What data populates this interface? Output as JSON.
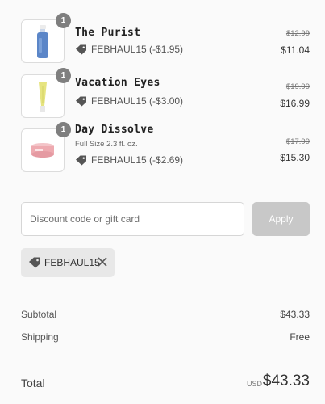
{
  "cart": {
    "items": [
      {
        "quantity": "1",
        "name": "The Purist",
        "variant": "",
        "discount": "FEBHAUL15 (-$1.95)",
        "original_price": "$12.99",
        "price": "$11.04",
        "image": "blue-bottle-product"
      },
      {
        "quantity": "1",
        "name": "Vacation Eyes",
        "variant": "",
        "discount": "FEBHAUL15 (-$3.00)",
        "original_price": "$19.99",
        "price": "$16.99",
        "image": "yellow-tube-product"
      },
      {
        "quantity": "1",
        "name": "Day Dissolve",
        "variant": "Full Size 2.3 fl. oz.",
        "discount": "FEBHAUL15 (-$2.69)",
        "original_price": "$17.99",
        "price": "$15.30",
        "image": "pink-jar-product"
      }
    ]
  },
  "discount": {
    "placeholder": "Discount code or gift card",
    "value": "",
    "apply_label": "Apply",
    "applied_code": "FEBHAUL15"
  },
  "summary": {
    "subtotal_label": "Subtotal",
    "subtotal_value": "$43.33",
    "shipping_label": "Shipping",
    "shipping_value": "Free",
    "total_label": "Total",
    "currency": "USD",
    "total_value": "$43.33"
  },
  "icons": {
    "tag": "tag-icon",
    "close": "close-icon",
    "quantity_badge": "quantity-badge"
  },
  "colors": {
    "badge": "#7f7f7f",
    "apply_button": "#c8c8c8",
    "chip_background": "#e8e8e8",
    "tag_icon": "#555555"
  }
}
